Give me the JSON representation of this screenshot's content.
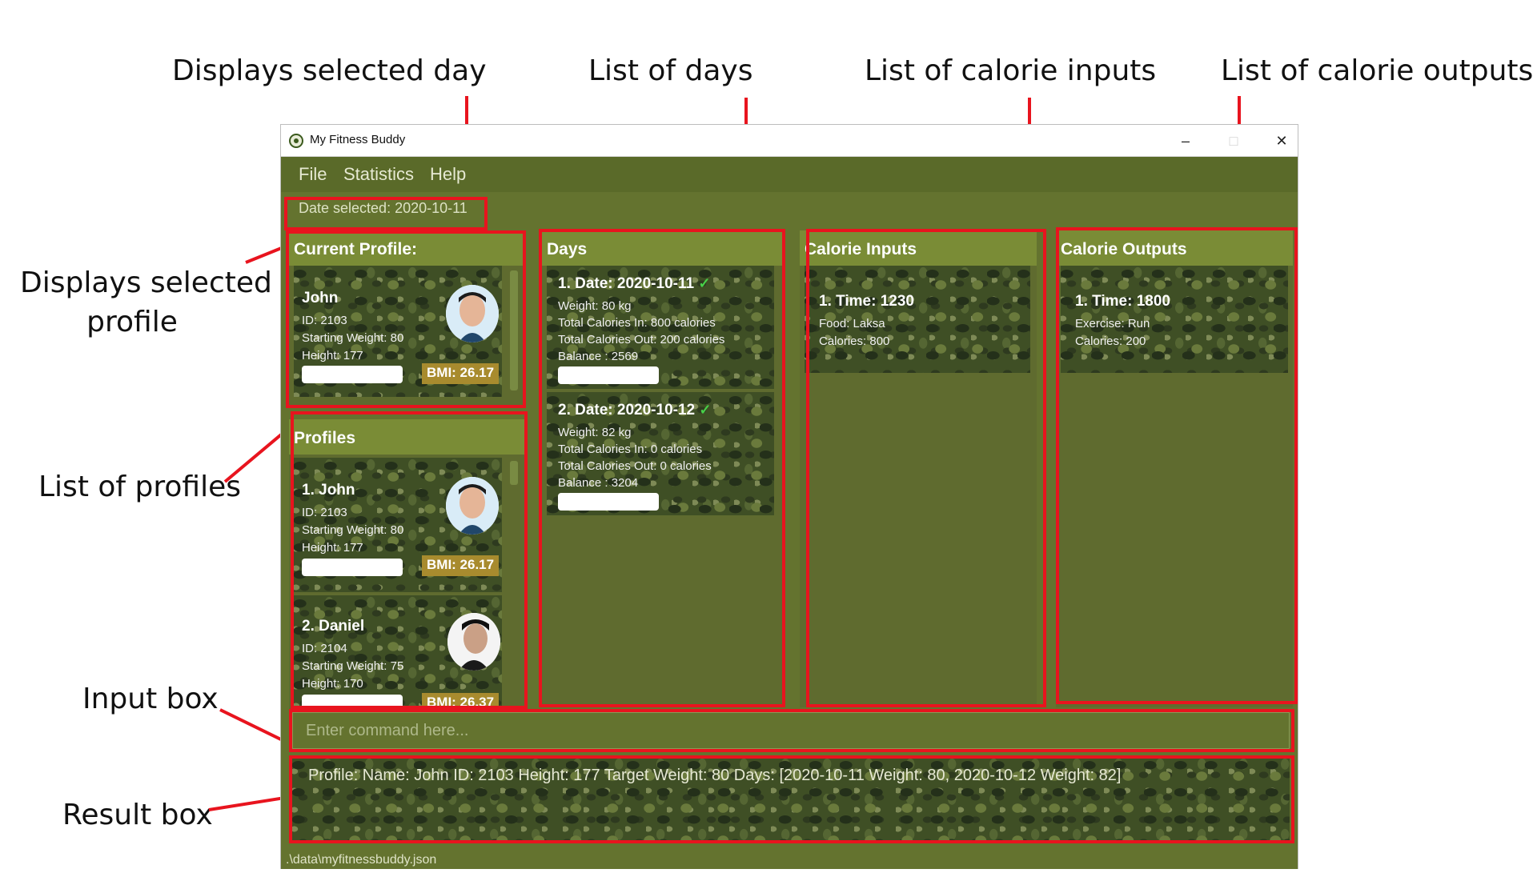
{
  "annotations": {
    "selected_day": "Displays selected day",
    "list_of_days": "List of days",
    "calorie_inputs": "List of calorie inputs",
    "calorie_outputs": "List of calorie outputs",
    "selected_profile": [
      "Displays selected",
      "profile"
    ],
    "list_of_profiles": "List of profiles",
    "input_box": "Input box",
    "result_box": "Result box"
  },
  "window": {
    "title": "My Fitness Buddy",
    "minimize": "–",
    "maximize": "□",
    "close": "✕"
  },
  "menu": [
    "File",
    "Statistics",
    "Help"
  ],
  "date_selected": "Date selected: 2020-10-11",
  "current_profile": {
    "title": "Current Profile:",
    "name": "John",
    "id": "ID: 2103",
    "starting_weight": "Starting Weight: 80",
    "height": "Height: 177",
    "bmi": "BMI: 26.17"
  },
  "profiles": {
    "title": "Profiles",
    "items": [
      {
        "name": "1.  John",
        "id": "ID: 2103",
        "starting_weight": "Starting Weight: 80",
        "height": "Height: 177",
        "bmi": "BMI: 26.17"
      },
      {
        "name": "2.  Daniel",
        "id": "ID: 2104",
        "starting_weight": "Starting Weight: 75",
        "height": "Height: 170",
        "bmi": "BMI: 26.37"
      }
    ]
  },
  "days": {
    "title": "Days",
    "items": [
      {
        "date": "1.  Date: 2020-10-11",
        "weight": "Weight: 80 kg",
        "cal_in": "Total Calories In: 800 calories",
        "cal_out": "Total Calories Out: 200 calories",
        "balance": "Balance : 2569"
      },
      {
        "date": "2.  Date: 2020-10-12",
        "weight": "Weight: 82 kg",
        "cal_in": "Total Calories In: 0 calories",
        "cal_out": "Total Calories Out: 0 calories",
        "balance": "Balance : 3204"
      }
    ]
  },
  "calorie_inputs": {
    "title": "Calorie Inputs",
    "items": [
      {
        "time": "1.  Time: 1230",
        "food": "Food: Laksa",
        "calories": "Calories: 800"
      }
    ]
  },
  "calorie_outputs": {
    "title": "Calorie Outputs",
    "items": [
      {
        "time": "1.  Time: 1800",
        "exercise": "Exercise: Run",
        "calories": "Calories: 200"
      }
    ]
  },
  "command": {
    "placeholder": "Enter command here..."
  },
  "result": "Profile:  Name: John ID: 2103 Height: 177 Target Weight: 80 Days: [2020-10-11 Weight: 80, 2020-10-12 Weight: 82]",
  "status": ".\\data\\myfitnessbuddy.json",
  "colors": {
    "accent": "#e8141e",
    "panel_header": "#7a8c36",
    "background": "#64732f",
    "bmi_badge": "#a88b2e"
  }
}
